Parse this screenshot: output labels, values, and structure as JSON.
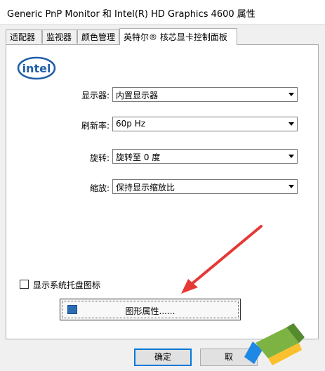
{
  "window": {
    "title": "Generic PnP Monitor 和 Intel(R) HD Graphics 4600 属性"
  },
  "tabs": [
    {
      "label": "适配器"
    },
    {
      "label": "监视器"
    },
    {
      "label": "颜色管理"
    },
    {
      "label": "英特尔® 核芯显卡控制面板",
      "active": true
    }
  ],
  "panel": {
    "logo_text": "intel",
    "display": {
      "label": "显示器:",
      "value": "内置显示器"
    },
    "refresh": {
      "label": "刷新率:",
      "value": "60p Hz"
    },
    "rotation": {
      "label": "旋转:",
      "value": "旋转至 0 度"
    },
    "scaling": {
      "label": "缩放:",
      "value": "保持显示缩放比"
    },
    "tray_checkbox": {
      "label": "显示系统托盘图标",
      "checked": false
    },
    "graphics_button": {
      "label": "图形属性......"
    }
  },
  "footer": {
    "ok_label": "确定",
    "cancel_label": "取"
  },
  "colors": {
    "accent": "#0078d7",
    "intel_blue": "#1f5fa8",
    "annotation_red": "#e53935"
  }
}
